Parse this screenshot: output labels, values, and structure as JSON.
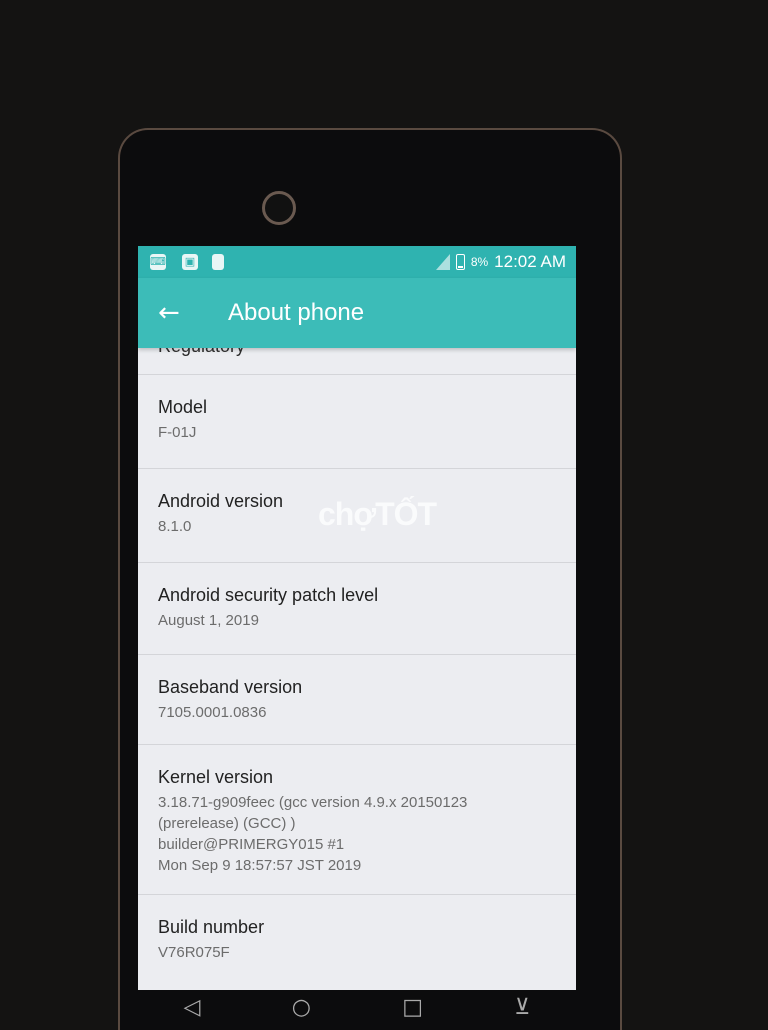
{
  "status_bar": {
    "battery_percent": "8%",
    "time": "12:02 AM",
    "left_icons": [
      "keyboard-icon",
      "screenshot-icon",
      "sd-card-icon"
    ]
  },
  "app_bar": {
    "title": "About phone",
    "back_icon": "arrow-left-icon"
  },
  "list": {
    "cut_off_item": "Regulatory",
    "items": [
      {
        "label": "Model",
        "value": "F-01J"
      },
      {
        "label": "Android version",
        "value": "8.1.0"
      },
      {
        "label": "Android security patch level",
        "value": "August 1, 2019"
      },
      {
        "label": "Baseband version",
        "value": "7105.0001.0836"
      },
      {
        "label": "Kernel version",
        "value": "3.18.71-g909feec (gcc version 4.9.x 20150123\n(prerelease) (GCC) )\nbuilder@PRIMERGY015 #1\nMon Sep 9 18:57:57 JST 2019"
      },
      {
        "label": "Build number",
        "value": "V76R075F"
      }
    ]
  },
  "watermark": "chợTỐT",
  "nav_bar": [
    "back-icon",
    "home-icon",
    "recents-icon",
    "down-icon"
  ]
}
